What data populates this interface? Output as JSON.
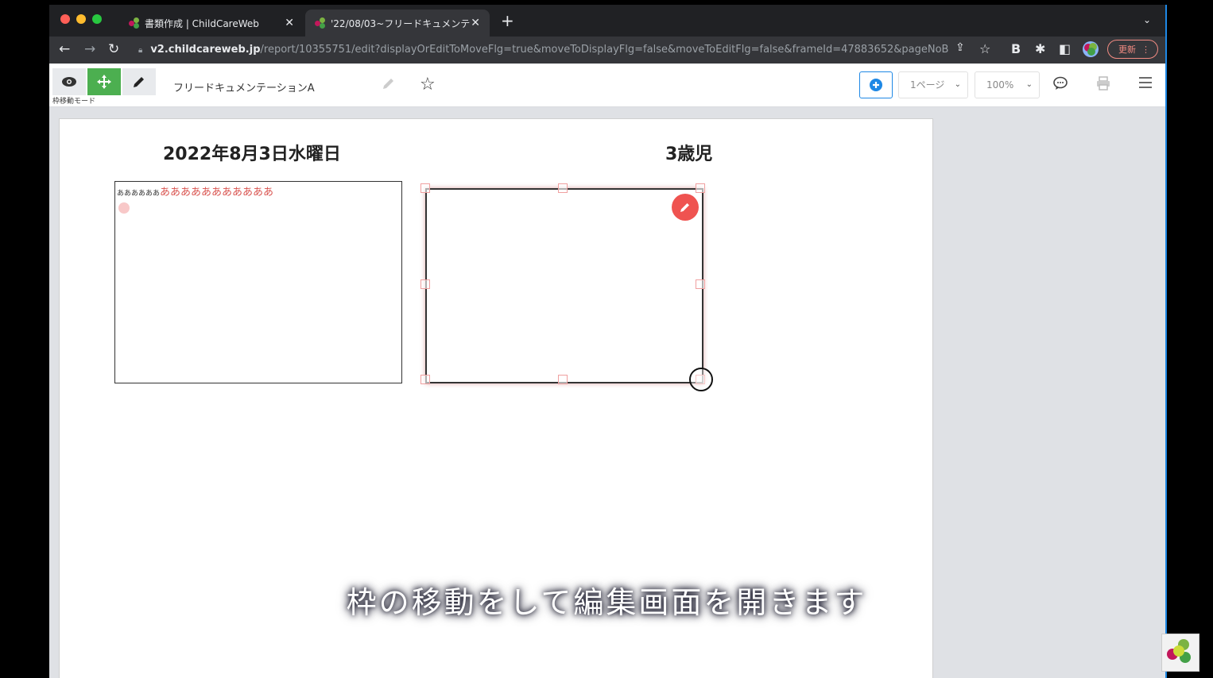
{
  "browser": {
    "tabs": [
      {
        "title": "書類作成 | ChildCareWeb"
      },
      {
        "title": "'22/08/03~フリードキュメンテ"
      }
    ],
    "url_host": "v2.childcareweb.jp",
    "url_path": "/report/10355751/edit?displayOrEditToMoveFlg=true&moveToDisplayFlg=false&moveToEditFlg=false&frameId=47883652&pageNoBef...",
    "update_label": "更新"
  },
  "app": {
    "mode_label": "枠移動モード",
    "doc_title": "フリードキュメンテーションA",
    "page_select": "1ページ",
    "zoom_select": "100%"
  },
  "document": {
    "date": "2022年8月3日水曜日",
    "age": "3歳児",
    "frame1_small_text": "ああああああ",
    "frame1_large_text": "あああああああああああ"
  },
  "caption": "枠の移動をして編集画面を開きます",
  "colors": {
    "accent_green": "#4caf50",
    "accent_blue": "#1e88e5",
    "edit_red": "#ef5350"
  }
}
